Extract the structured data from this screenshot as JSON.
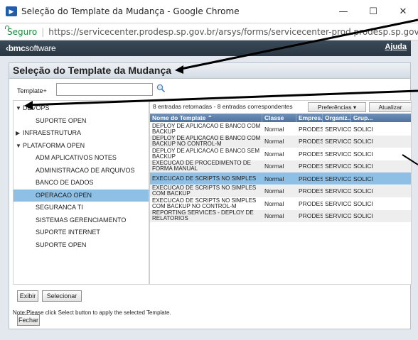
{
  "browser": {
    "window_title": "Seleção do Template da Mudança - Google Chrome",
    "minimize": "—",
    "maximize": "☐",
    "close": "✕",
    "secure_label": "Seguro",
    "separator": "|",
    "url": "https://servicecenter.prodesp.sp.gov.br/arsys/forms/servicecenter-prod.prodesp.sp.gov.br/CHG%..."
  },
  "app": {
    "logo_prefix": "‹bmc",
    "logo_suffix": "software",
    "help_link": "Ajuda"
  },
  "page": {
    "title": "Seleção do Template da Mudança",
    "template_label": "Template+",
    "template_value": ""
  },
  "tree": {
    "items": [
      {
        "label": "DEVOPS",
        "arrow": "▼",
        "level": 0
      },
      {
        "label": "SUPORTE OPEN",
        "arrow": "",
        "level": 1
      },
      {
        "label": "INFRAESTRUTURA",
        "arrow": "▶",
        "level": 0
      },
      {
        "label": "PLATAFORMA OPEN",
        "arrow": "▼",
        "level": 0
      },
      {
        "label": "ADM APLICATIVOS NOTES",
        "arrow": "",
        "level": 1
      },
      {
        "label": "ADMINISTRACAO DE ARQUIVOS",
        "arrow": "",
        "level": 1
      },
      {
        "label": "BANCO DE DADOS",
        "arrow": "",
        "level": 1
      },
      {
        "label": "OPERACAO OPEN",
        "arrow": "",
        "level": 1,
        "selected": true
      },
      {
        "label": "SEGURANCA TI",
        "arrow": "",
        "level": 1
      },
      {
        "label": "SISTEMAS GERENCIAMENTO",
        "arrow": "",
        "level": 1
      },
      {
        "label": "SUPORTE INTERNET",
        "arrow": "",
        "level": 1
      },
      {
        "label": "SUPORTE OPEN",
        "arrow": "",
        "level": 1
      }
    ]
  },
  "grid": {
    "count_text": "8 entradas retornadas - 8 entradas correspondentes",
    "preferences_button": "Preferências ▾",
    "refresh_button": "Atualizar",
    "columns": [
      "Nome do Template ⌃",
      "Classe",
      "Empres...",
      "Organiz...",
      "Grup..."
    ],
    "rows": [
      [
        "DEPLOY DE APLICACAO E BANCO COM BACKUP",
        "Normal",
        "PRODESP",
        "SERVICOS",
        "SOLICI"
      ],
      [
        "DEPLOY DE APLICACAO E BANCO COM BACKUP NO CONTROL-M",
        "Normal",
        "PRODESP",
        "SERVICOS",
        "SOLICI"
      ],
      [
        "DEPLOY DE APLICACAO E BANCO SEM BACKUP",
        "Normal",
        "PRODESP",
        "SERVICOS",
        "SOLICI"
      ],
      [
        "EXECUCAO DE PROCEDIMENTO DE FORMA MANUAL",
        "Normal",
        "PRODESP",
        "SERVICOS",
        "SOLICI"
      ],
      [
        "EXECUCAO DE SCRIPTS NO SIMPLES",
        "Normal",
        "PRODESP",
        "SERVICOS",
        "SOLICI"
      ],
      [
        "EXECUCAO DE SCRIPTS NO SIMPLES COM BACKUP",
        "Normal",
        "PRODESP",
        "SERVICOS",
        "SOLICI"
      ],
      [
        "EXECUCAO DE SCRIPTS NO SIMPLES COM BACKUP NO CONTROL-M",
        "Normal",
        "PRODESP",
        "SERVICOS",
        "SOLICI"
      ],
      [
        "REPORTING SERVICES - DEPLOY DE RELATORIOS",
        "Normal",
        "PRODESP",
        "SERVICOS",
        "SOLICI"
      ]
    ],
    "selected_row": 4
  },
  "buttons": {
    "view": "Exibir",
    "select": "Selecionar",
    "close": "Fechar"
  },
  "note": "Note:Please click Select button to apply the selected Template.",
  "colors": {
    "selection": "#8ec0e6",
    "grid_header": "#5a7caa",
    "bmc_bar": "#2f3b48"
  }
}
